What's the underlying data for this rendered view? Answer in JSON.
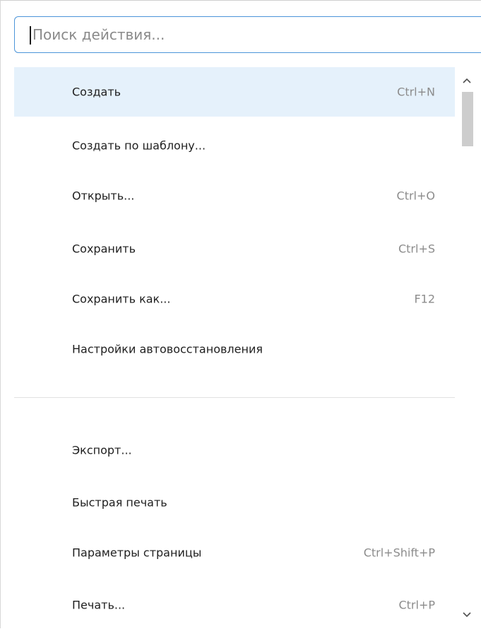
{
  "search": {
    "placeholder": "Поиск действия...",
    "value": ""
  },
  "items": [
    {
      "label": "Создать",
      "shortcut": "Ctrl+N",
      "active": true
    },
    {
      "label": "Создать по шаблону...",
      "shortcut": ""
    },
    {
      "label": "Открыть...",
      "shortcut": "Ctrl+O"
    },
    {
      "label": "Сохранить",
      "shortcut": "Ctrl+S"
    },
    {
      "label": "Сохранить как...",
      "shortcut": "F12"
    },
    {
      "label": "Настройки автовосстановления",
      "shortcut": ""
    },
    {
      "label": "Экспорт...",
      "shortcut": ""
    },
    {
      "label": "Быстрая печать",
      "shortcut": ""
    },
    {
      "label": "Параметры страницы",
      "shortcut": "Ctrl+Shift+P"
    },
    {
      "label": "Печать...",
      "shortcut": "Ctrl+P"
    }
  ],
  "scrollbar": {
    "up_icon": "chevron-up-icon",
    "down_icon": "chevron-down-icon"
  },
  "colors": {
    "accent_border": "#4c95d9",
    "active_row": "#e5f1fb",
    "shortcut_text": "#8c8c8c"
  }
}
